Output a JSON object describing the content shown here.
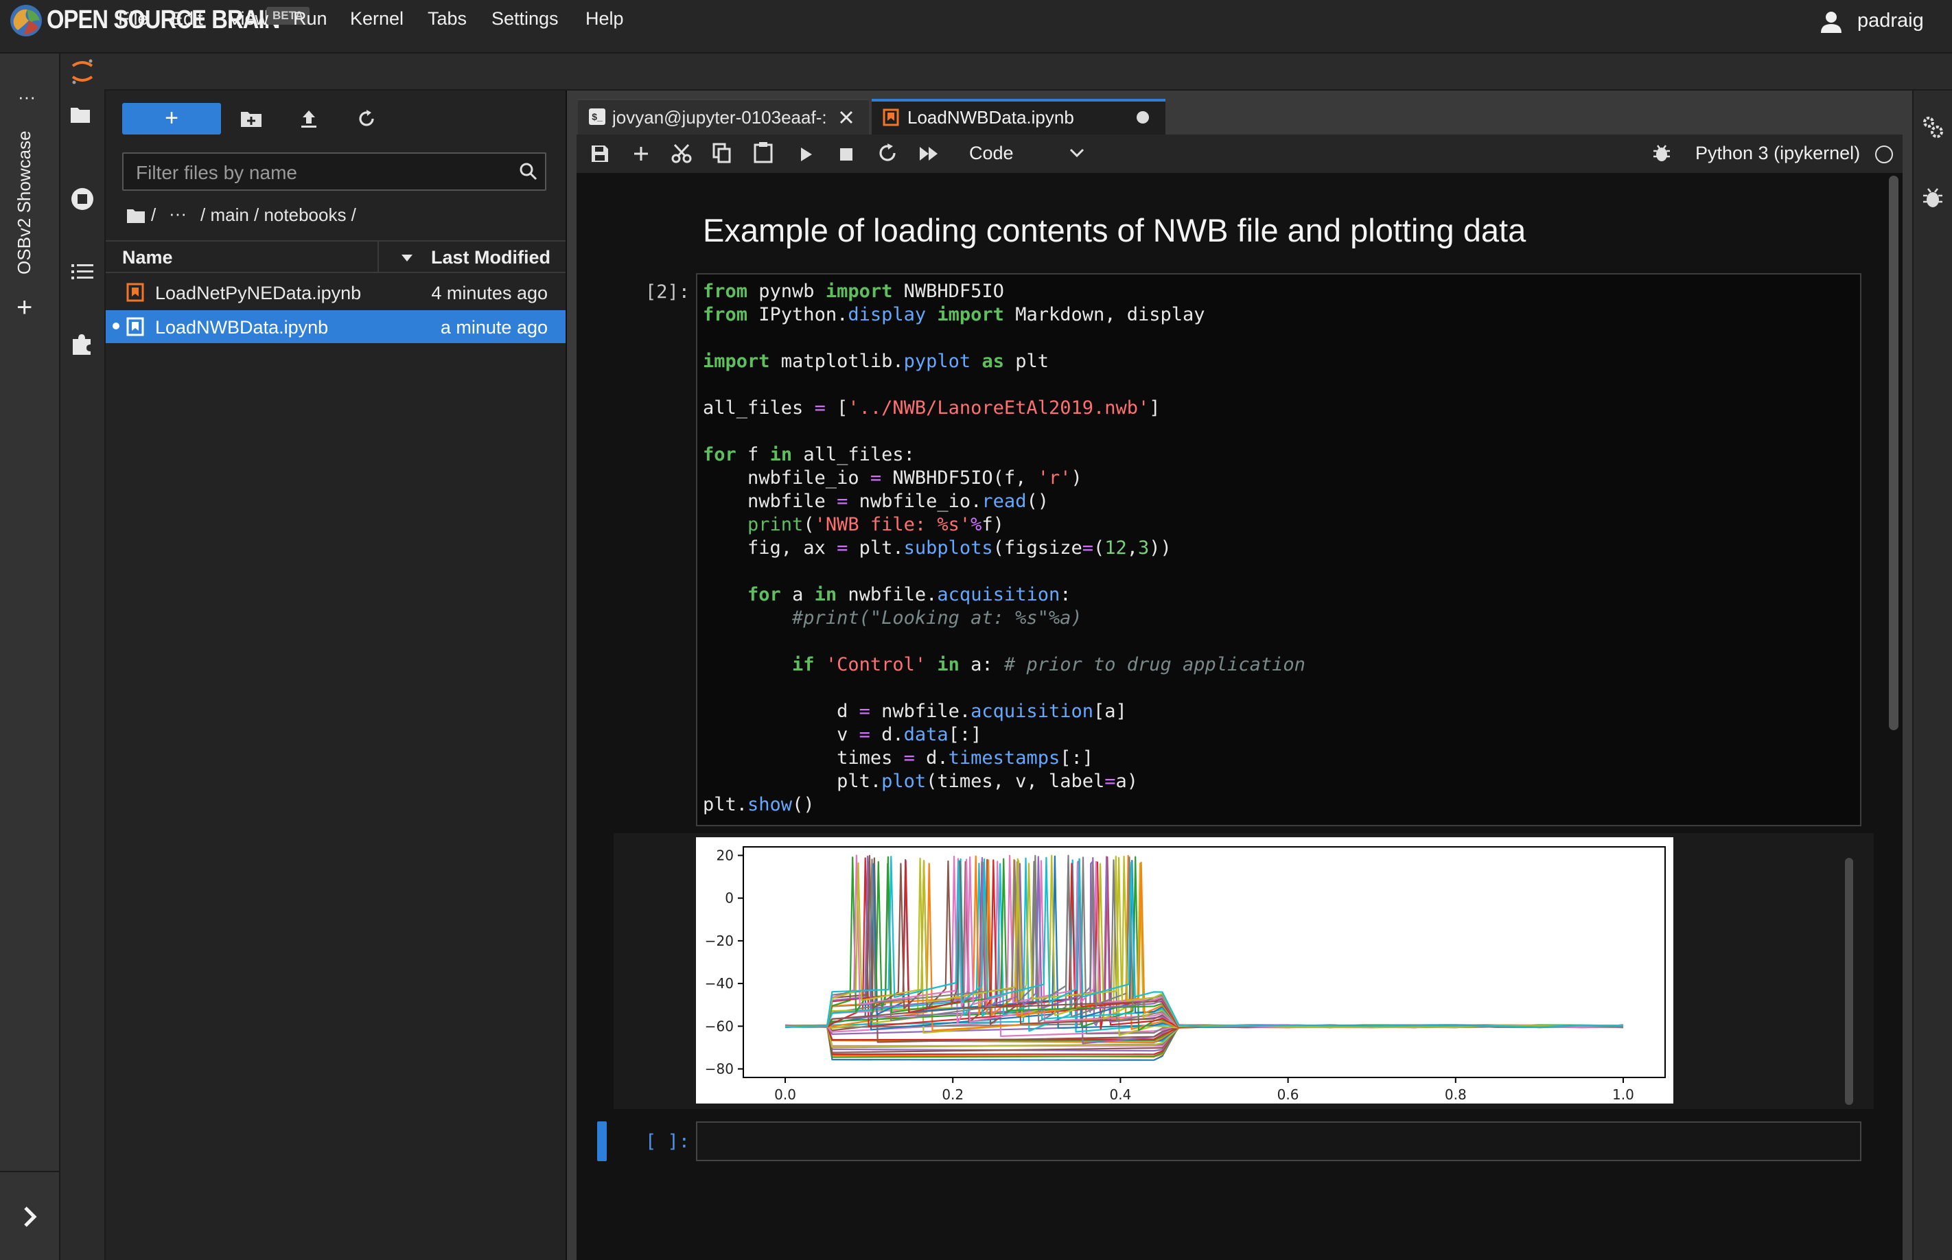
{
  "brand": {
    "name": "OPEN SOURCE BRAIN",
    "badge": "BETA"
  },
  "user": {
    "name": "padraig",
    "icon": "user-icon"
  },
  "left_bar": {
    "showcase_label": "OSBv2 Showcase",
    "more_label": "···",
    "add_label": "+",
    "expand_label": "›"
  },
  "menu": [
    "File",
    "Edit",
    "View",
    "Run",
    "Kernel",
    "Tabs",
    "Settings",
    "Help"
  ],
  "file_browser": {
    "new_button": "+",
    "filter_placeholder": "Filter files by name",
    "breadcrumb": {
      "root": "/",
      "ellipsis": "···",
      "path": "/ main / notebooks /"
    },
    "columns": {
      "name": "Name",
      "modified": "Last Modified"
    },
    "files": [
      {
        "name": "LoadNetPyNEData.ipynb",
        "modified": "4 minutes ago",
        "selected": false
      },
      {
        "name": "LoadNWBData.ipynb",
        "modified": "a minute ago",
        "selected": true
      }
    ]
  },
  "tabs": [
    {
      "label": "jovyan@jupyter-0103eaaf-:",
      "icon": "terminal-icon",
      "active": false
    },
    {
      "label": "LoadNWBData.ipynb",
      "icon": "notebook-icon",
      "active": true
    }
  ],
  "toolbar": {
    "cell_type": "Code",
    "kernel": "Python 3 (ipykernel)"
  },
  "notebook": {
    "title": "Example of loading contents of NWB file and plotting data",
    "code_prompt": "[2]:",
    "empty_prompt": "[ ]:"
  },
  "chart_data": {
    "type": "line",
    "title": "",
    "xlabel": "",
    "ylabel": "",
    "xlim": [
      0.0,
      1.0
    ],
    "ylim": [
      -80,
      20
    ],
    "x_ticks": [
      "0.0",
      "0.2",
      "0.4",
      "0.6",
      "0.8",
      "1.0"
    ],
    "y_ticks": [
      "20",
      "0",
      "−20",
      "−40",
      "−60",
      "−80"
    ],
    "description": "Many overlaid voltage traces: baseline about -60 from 0 to 0.05, hyperpolarised/depolarised steps with spikes reaching about 20 between 0.07 and 0.44, return to about -60 until 1.0",
    "baseline": -60,
    "step_window": [
      0.05,
      0.45
    ],
    "spike_peak": 20
  }
}
